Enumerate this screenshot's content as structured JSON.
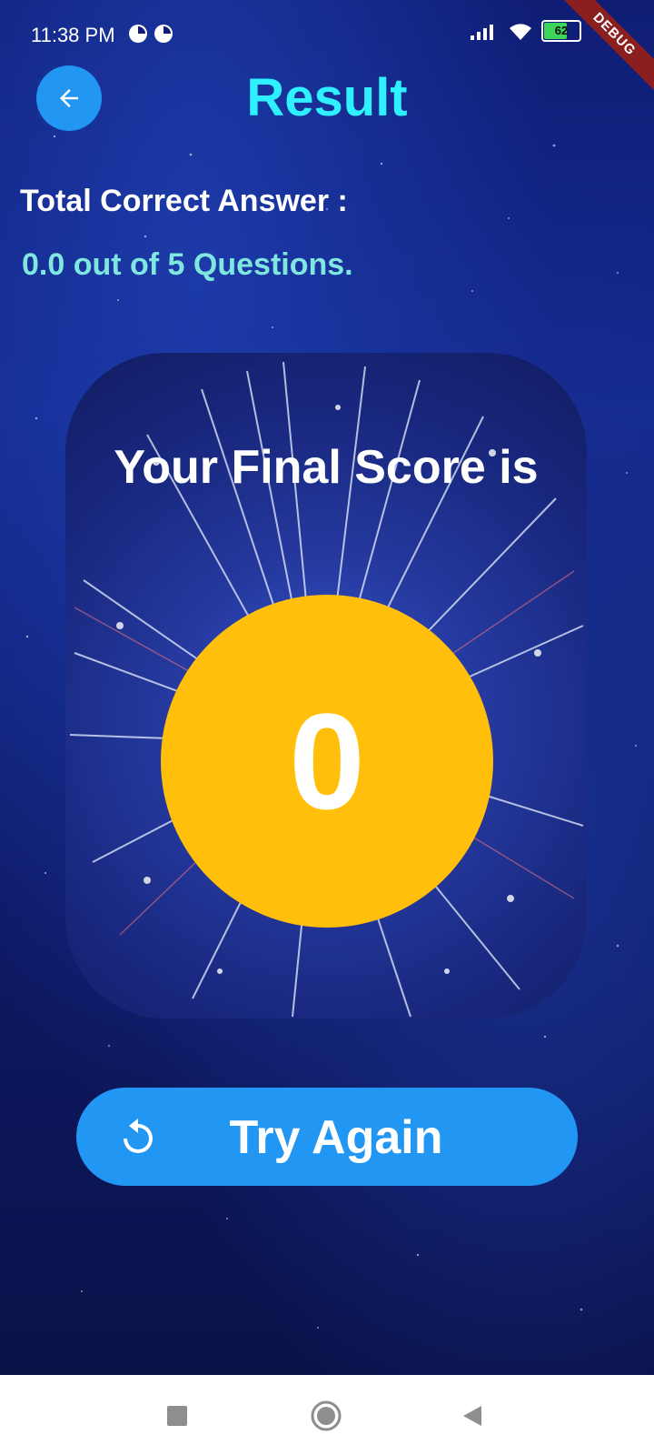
{
  "status_bar": {
    "time": "11:38 PM",
    "battery": "62",
    "debug_banner": "DEBUG"
  },
  "header": {
    "title": "Result",
    "back_icon": "arrow-left-icon"
  },
  "summary": {
    "label": "Total Correct Answer :",
    "value": "0.0 out of 5 Questions."
  },
  "score_card": {
    "title": "Your Final Score is",
    "score": "0"
  },
  "actions": {
    "try_again_label": "Try Again",
    "try_again_icon": "refresh-icon"
  },
  "colors": {
    "accent_blue": "#2196f3",
    "title_cyan": "#2ef0ff",
    "value_teal": "#7fe7df",
    "score_yellow": "#ffbf0b"
  }
}
